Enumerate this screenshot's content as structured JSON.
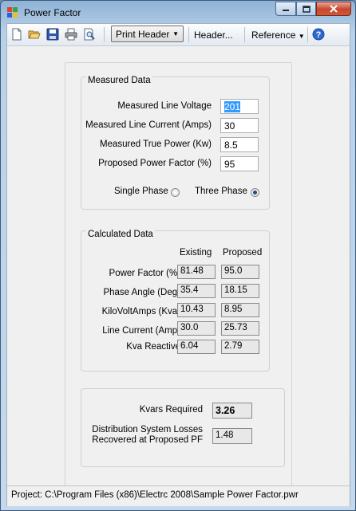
{
  "window": {
    "title": "Power Factor"
  },
  "toolbar": {
    "print_header_label": "Print Header",
    "header_label": "Header...",
    "reference_label": "Reference",
    "icons": [
      "new-file-icon",
      "open-folder-icon",
      "save-icon",
      "print-icon",
      "print-preview-icon",
      "help-icon"
    ]
  },
  "measured": {
    "title": "Measured Data",
    "voltage_label": "Measured Line Voltage",
    "voltage_value": "201",
    "current_label": "Measured Line Current (Amps)",
    "current_value": "30",
    "power_label": "Measured True Power (Kw)",
    "power_value": "8.5",
    "pf_label": "Proposed Power Factor (%)",
    "pf_value": "95",
    "single_phase_label": "Single Phase",
    "three_phase_label": "Three Phase",
    "selected_phase": "Three Phase"
  },
  "calculated": {
    "title": "Calculated Data",
    "col_existing": "Existing",
    "col_proposed": "Proposed",
    "rows": [
      {
        "label": "Power Factor (%)",
        "existing": "81.48",
        "proposed": "95.0"
      },
      {
        "label": "Phase Angle (Deg)",
        "existing": "35.4",
        "proposed": "18.15"
      },
      {
        "label": "KiloVoltAmps (Kva)",
        "existing": "10.43",
        "proposed": "8.95"
      },
      {
        "label": "Line Current (Amp)",
        "existing": "30.0",
        "proposed": "25.73"
      },
      {
        "label": "Kva Reactive",
        "existing": "6.04",
        "proposed": "2.79"
      }
    ]
  },
  "results": {
    "kvars_label": "Kvars Required",
    "kvars_value": "3.26",
    "losses_label_1": "Distribution System Losses",
    "losses_label_2": "Recovered at Proposed PF",
    "losses_value": "1.48"
  },
  "status": {
    "text": "Project: C:\\Program Files (x86)\\Electrc 2008\\Sample Power Factor.pwr"
  }
}
